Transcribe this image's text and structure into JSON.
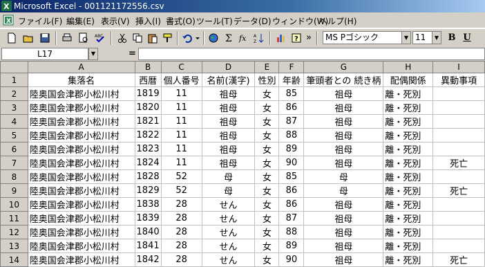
{
  "window": {
    "title": "Microsoft Excel - 001121172556.csv",
    "app_icon": "excel-icon"
  },
  "menu": {
    "items": [
      "ファイル(F)",
      "編集(E)",
      "表示(V)",
      "挿入(I)",
      "書式(O)",
      "ツール(T)",
      "データ(D)",
      "ウィンドウ(W)",
      "ヘルプ(H)"
    ]
  },
  "toolbar": {
    "font_name": "MS Pゴシック",
    "font_size": "11",
    "bold_label": "B",
    "underline_label": "U",
    "overflow_label": "»"
  },
  "formula_bar": {
    "cell_ref": "L17",
    "equals_sign": "=",
    "formula": ""
  },
  "grid": {
    "column_headers": [
      "A",
      "B",
      "C",
      "D",
      "E",
      "F",
      "G",
      "H",
      "I"
    ],
    "rows": [
      {
        "n": "1",
        "cells": [
          "集落名",
          "西暦",
          "個人番号",
          "名前(漢字)",
          "性別",
          "年齢",
          "筆頭者との 続き柄",
          "配偶関係",
          "異動事項"
        ]
      },
      {
        "n": "2",
        "cells": [
          "陸奥国会津郡小松川村",
          "1819",
          "11",
          "祖母",
          "女",
          "85",
          "祖母",
          "離・死別",
          ""
        ]
      },
      {
        "n": "3",
        "cells": [
          "陸奥国会津郡小松川村",
          "1820",
          "11",
          "祖母",
          "女",
          "86",
          "祖母",
          "離・死別",
          ""
        ]
      },
      {
        "n": "4",
        "cells": [
          "陸奥国会津郡小松川村",
          "1821",
          "11",
          "祖母",
          "女",
          "87",
          "祖母",
          "離・死別",
          ""
        ]
      },
      {
        "n": "5",
        "cells": [
          "陸奥国会津郡小松川村",
          "1822",
          "11",
          "祖母",
          "女",
          "88",
          "祖母",
          "離・死別",
          ""
        ]
      },
      {
        "n": "6",
        "cells": [
          "陸奥国会津郡小松川村",
          "1823",
          "11",
          "祖母",
          "女",
          "89",
          "祖母",
          "離・死別",
          ""
        ]
      },
      {
        "n": "7",
        "cells": [
          "陸奥国会津郡小松川村",
          "1824",
          "11",
          "祖母",
          "女",
          "90",
          "祖母",
          "離・死別",
          "死亡"
        ]
      },
      {
        "n": "8",
        "cells": [
          "陸奥国会津郡小松川村",
          "1828",
          "52",
          "母",
          "女",
          "85",
          "母",
          "離・死別",
          ""
        ]
      },
      {
        "n": "9",
        "cells": [
          "陸奥国会津郡小松川村",
          "1829",
          "52",
          "母",
          "女",
          "86",
          "母",
          "離・死別",
          "死亡"
        ]
      },
      {
        "n": "10",
        "cells": [
          "陸奥国会津郡小松川村",
          "1838",
          "28",
          "せん",
          "女",
          "86",
          "祖母",
          "離・死別",
          ""
        ]
      },
      {
        "n": "11",
        "cells": [
          "陸奥国会津郡小松川村",
          "1839",
          "28",
          "せん",
          "女",
          "87",
          "祖母",
          "離・死別",
          ""
        ]
      },
      {
        "n": "12",
        "cells": [
          "陸奥国会津郡小松川村",
          "1840",
          "28",
          "せん",
          "女",
          "88",
          "祖母",
          "離・死別",
          ""
        ]
      },
      {
        "n": "13",
        "cells": [
          "陸奥国会津郡小松川村",
          "1841",
          "28",
          "せん",
          "女",
          "89",
          "祖母",
          "離・死別",
          ""
        ]
      },
      {
        "n": "14",
        "cells": [
          "陸奥国会津郡小松川村",
          "1842",
          "28",
          "せん",
          "女",
          "90",
          "祖母",
          "離・死別",
          "死亡"
        ]
      }
    ]
  },
  "colors": {
    "titlebar_start": "#0a246a",
    "chrome": "#d4d0c8",
    "grid_line": "#c0c0c0"
  }
}
